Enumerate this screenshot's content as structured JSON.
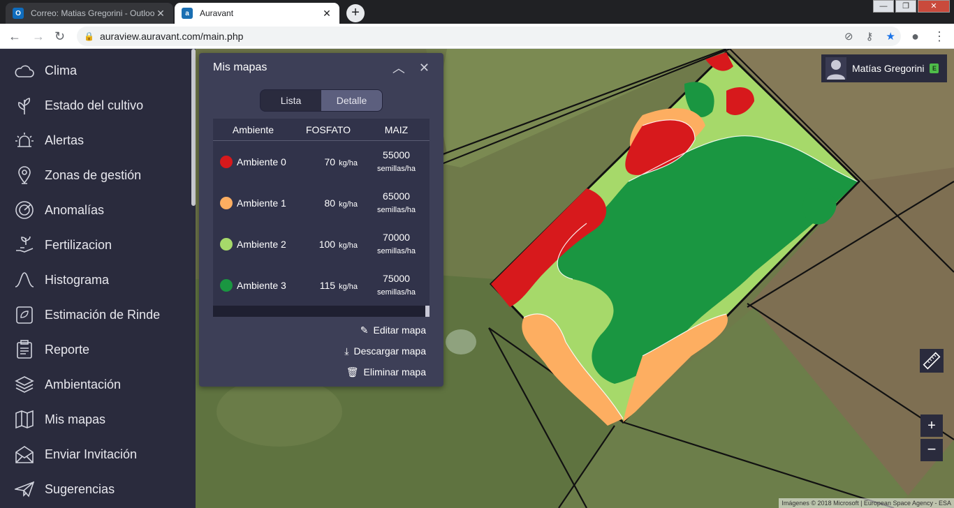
{
  "browser": {
    "tabs": [
      {
        "title": "Correo: Matias Gregorini - Outlook",
        "favicon": "outlook-icon",
        "close": "✕"
      },
      {
        "title": "Auravant",
        "favicon": "auravant-icon",
        "close": "✕"
      }
    ],
    "new_tab": "+",
    "url": "auraview.auravant.com/main.php"
  },
  "sidebar": {
    "items": [
      {
        "label": "Clima",
        "icon": "cloud-icon"
      },
      {
        "label": "Estado del cultivo",
        "icon": "plant-icon"
      },
      {
        "label": "Alertas",
        "icon": "alarm-icon"
      },
      {
        "label": "Zonas de gestión",
        "icon": "location-pin-icon"
      },
      {
        "label": "Anomalías",
        "icon": "radar-icon"
      },
      {
        "label": "Fertilizacion",
        "icon": "hand-plant-icon"
      },
      {
        "label": "Histograma",
        "icon": "bell-curve-icon"
      },
      {
        "label": "Estimación de Rinde",
        "icon": "seed-bag-icon"
      },
      {
        "label": "Reporte",
        "icon": "clipboard-icon"
      },
      {
        "label": "Ambientación",
        "icon": "layers-icon"
      },
      {
        "label": "Mis mapas",
        "icon": "map-icon"
      },
      {
        "label": "Enviar Invitación",
        "icon": "envelope-icon"
      },
      {
        "label": "Sugerencias",
        "icon": "paper-plane-icon"
      }
    ]
  },
  "panel": {
    "title": "Mis mapas",
    "tabs": {
      "list": "Lista",
      "detail": "Detalle"
    },
    "columns": [
      "Ambiente",
      "FOSFATO",
      "MAIZ"
    ],
    "rows": [
      {
        "name": "Ambiente 0",
        "color": "#d7191c",
        "fosfato": "70",
        "fosfato_unit": "kg/ha",
        "maiz": "55000",
        "maiz_unit": "semillas/ha"
      },
      {
        "name": "Ambiente 1",
        "color": "#fdae61",
        "fosfato": "80",
        "fosfato_unit": "kg/ha",
        "maiz": "65000",
        "maiz_unit": "semillas/ha"
      },
      {
        "name": "Ambiente 2",
        "color": "#a6d96a",
        "fosfato": "100",
        "fosfato_unit": "kg/ha",
        "maiz": "70000",
        "maiz_unit": "semillas/ha"
      },
      {
        "name": "Ambiente 3",
        "color": "#1a9641",
        "fosfato": "115",
        "fosfato_unit": "kg/ha",
        "maiz": "75000",
        "maiz_unit": "semillas/ha"
      }
    ],
    "actions": {
      "edit": "Editar mapa",
      "download": "Descargar mapa",
      "delete": "Eliminar mapa"
    }
  },
  "user": {
    "name": "Matías Gregorini",
    "badge": "E"
  },
  "map": {
    "attribution": "Imágenes © 2018 Microsoft | European Space Agency - ESA",
    "zoom_in": "+",
    "zoom_out": "−"
  }
}
